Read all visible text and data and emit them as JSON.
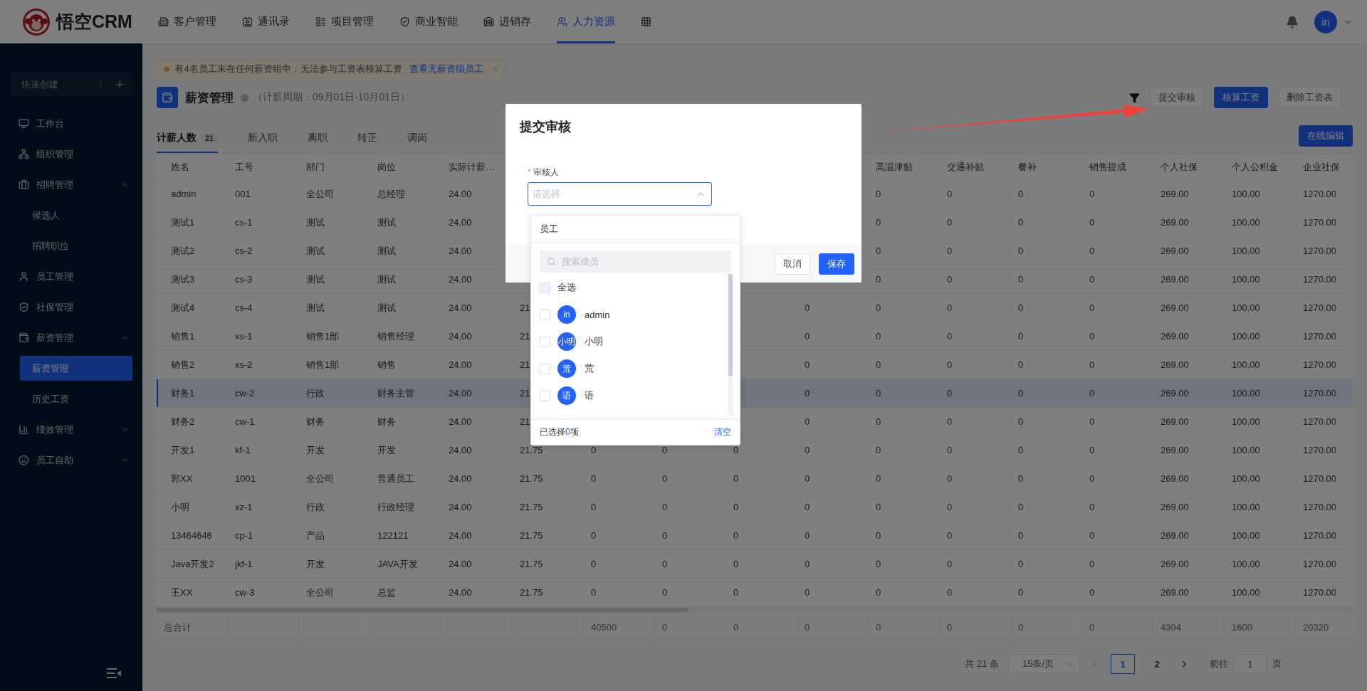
{
  "header": {
    "logo_text": "悟空CRM",
    "avatar": "in",
    "nav": [
      {
        "label": "客户管理",
        "selected": false
      },
      {
        "label": "通讯录",
        "selected": false
      },
      {
        "label": "项目管理",
        "selected": false
      },
      {
        "label": "商业智能",
        "selected": false
      },
      {
        "label": "进销存",
        "selected": false
      },
      {
        "label": "人力资源",
        "selected": true
      }
    ]
  },
  "sidebar": {
    "quick_create": "快速创建",
    "items": [
      {
        "label": "工作台",
        "selected": false
      },
      {
        "label": "组织管理",
        "selected": false
      },
      {
        "label": "招聘管理",
        "selected": false,
        "expanded": true,
        "children": [
          {
            "label": "候选人",
            "selected": false
          },
          {
            "label": "招聘职位",
            "selected": false
          }
        ]
      },
      {
        "label": "员工管理",
        "selected": false
      },
      {
        "label": "社保管理",
        "selected": false
      },
      {
        "label": "薪资管理",
        "selected": false,
        "expanded": true,
        "children": [
          {
            "label": "薪资管理",
            "selected": true
          },
          {
            "label": "历史工资",
            "selected": false
          }
        ]
      },
      {
        "label": "绩效管理",
        "selected": false,
        "expanded": false
      },
      {
        "label": "员工自助",
        "selected": false,
        "expanded": false
      }
    ]
  },
  "notice": {
    "text": "有4名员工未在任何薪资组中，无法参与工资表核算工资",
    "link": "查看无薪资组员工"
  },
  "page": {
    "title": "薪资管理",
    "period": "（计薪周期：09月01日-10月01日）",
    "actions": [
      {
        "label": "提交审核",
        "kind": "default"
      },
      {
        "label": "核算工资",
        "kind": "primary"
      },
      {
        "label": "删除工资表",
        "kind": "default"
      }
    ]
  },
  "tabs": [
    {
      "label": "计薪人数",
      "count": "21",
      "selected": true
    },
    {
      "label": "新入职",
      "selected": false
    },
    {
      "label": "离职",
      "selected": false
    },
    {
      "label": "转正",
      "selected": false
    },
    {
      "label": "调岗",
      "selected": false
    }
  ],
  "online_edit": "在线编辑",
  "table": {
    "columns": [
      "姓名",
      "工号",
      "部门",
      "岗位",
      "实际计薪…",
      null,
      null,
      null,
      null,
      null,
      "高温津贴",
      "交通补贴",
      "餐补",
      "销售提成",
      "个人社保",
      "个人公积金",
      "企业社保"
    ],
    "rows": [
      {
        "selected": false,
        "cells": [
          "admin",
          "001",
          "全公司",
          "总经理",
          "24.00",
          null,
          null,
          null,
          null,
          null,
          "0",
          "0",
          "0",
          "0",
          "269.00",
          "100.00",
          "1270.00"
        ]
      },
      {
        "selected": false,
        "cells": [
          "测试1",
          "cs-1",
          "测试",
          "测试",
          "24.00",
          null,
          null,
          null,
          null,
          null,
          "0",
          "0",
          "0",
          "0",
          "269.00",
          "100.00",
          "1270.00"
        ]
      },
      {
        "selected": false,
        "cells": [
          "测试2",
          "cs-2",
          "测试",
          "测试",
          "24.00",
          null,
          null,
          null,
          null,
          null,
          "0",
          "0",
          "0",
          "0",
          "269.00",
          "100.00",
          "1270.00"
        ]
      },
      {
        "selected": false,
        "cells": [
          "测试3",
          "cs-3",
          "测试",
          "测试",
          "24.00",
          null,
          null,
          null,
          null,
          null,
          "0",
          "0",
          "0",
          "0",
          "269.00",
          "100.00",
          "1270.00"
        ]
      },
      {
        "selected": false,
        "cells": [
          "测试4",
          "cs-4",
          "测试",
          "测试",
          "24.00",
          "21",
          null,
          null,
          null,
          "0",
          "0",
          "0",
          "0",
          "0",
          "269.00",
          "100.00",
          "1270.00"
        ]
      },
      {
        "selected": false,
        "cells": [
          "销售1",
          "xs-1",
          "销售1部",
          "销售经理",
          "24.00",
          "21",
          null,
          null,
          null,
          "0",
          "0",
          "0",
          "0",
          "0",
          "269.00",
          "100.00",
          "1270.00"
        ]
      },
      {
        "selected": false,
        "cells": [
          "销售2",
          "xs-2",
          "销售1部",
          "销售",
          "24.00",
          "21",
          null,
          null,
          null,
          "0",
          "0",
          "0",
          "0",
          "0",
          "269.00",
          "100.00",
          "1270.00"
        ]
      },
      {
        "selected": true,
        "cells": [
          "财务1",
          "cw-2",
          "行政",
          "财务主管",
          "24.00",
          "21",
          null,
          null,
          null,
          "0",
          "0",
          "0",
          "0",
          "0",
          "269.00",
          "100.00",
          "1270.00"
        ]
      },
      {
        "selected": false,
        "cells": [
          "财务2",
          "cw-1",
          "财务",
          "财务",
          "24.00",
          "21",
          null,
          null,
          null,
          "0",
          "0",
          "0",
          "0",
          "0",
          "269.00",
          "100.00",
          "1270.00"
        ]
      },
      {
        "selected": false,
        "cells": [
          "开发1",
          "kf-1",
          "开发",
          "开发",
          "24.00",
          "21.75",
          "0",
          "0",
          "0",
          "0",
          "0",
          "0",
          "0",
          "0",
          "269.00",
          "100.00",
          "1270.00"
        ]
      },
      {
        "selected": false,
        "cells": [
          "郭XX",
          "1001",
          "全公司",
          "普通员工",
          "24.00",
          "21.75",
          "0",
          "0",
          "0",
          "0",
          "0",
          "0",
          "0",
          "0",
          "269.00",
          "100.00",
          "1270.00"
        ]
      },
      {
        "selected": false,
        "cells": [
          "小明",
          "xz-1",
          "行政",
          "行政经理",
          "24.00",
          "21.75",
          "0",
          "0",
          "0",
          "0",
          "0",
          "0",
          "0",
          "0",
          "269.00",
          "100.00",
          "1270.00"
        ]
      },
      {
        "selected": false,
        "cells": [
          "13464646",
          "cp-1",
          "产品",
          "122121",
          "24.00",
          "21.75",
          "0",
          "0",
          "0",
          "0",
          "0",
          "0",
          "0",
          "0",
          "269.00",
          "100.00",
          "1270.00"
        ]
      },
      {
        "selected": false,
        "cells": [
          "Java开发2",
          "jkf-1",
          "开发",
          "JAVA开发",
          "24.00",
          "21.75",
          "0",
          "0",
          "0",
          "0",
          "0",
          "0",
          "0",
          "0",
          "269.00",
          "100.00",
          "1270.00"
        ]
      },
      {
        "selected": false,
        "cells": [
          "王XX",
          "cw-3",
          "全公司",
          "总监",
          "24.00",
          "21.75",
          "0",
          "0",
          "0",
          "0",
          "0",
          "0",
          "0",
          "0",
          "269.00",
          "100.00",
          "1270.00"
        ]
      }
    ],
    "total": {
      "label": "总合计",
      "values": [
        "40500",
        "0",
        "0",
        "0",
        "0",
        "0",
        "0",
        "0",
        "4304",
        "1600",
        "20320"
      ]
    }
  },
  "pagination": {
    "total": "共 21 条",
    "page_size": "15条/页",
    "prev_disabled": true,
    "next_disabled": false,
    "pages": [
      {
        "label": "1",
        "selected": true
      },
      {
        "label": "2",
        "selected": false
      }
    ],
    "goto_label": "前往",
    "goto_value": "1",
    "goto_suffix": "页"
  },
  "modal": {
    "title": "提交审核",
    "required_mark": "*",
    "field_label": "审核人",
    "placeholder": "请选择",
    "buttons": [
      {
        "label": "取消",
        "kind": "default"
      },
      {
        "label": "保存",
        "kind": "primary"
      }
    ]
  },
  "picker": {
    "tab": "员工",
    "search_placeholder": "搜索成员",
    "select_all": {
      "label": "全选",
      "checked": false
    },
    "members": [
      {
        "avatar": "in",
        "name": "admin",
        "checked": false
      },
      {
        "avatar": "小明",
        "name": "小明",
        "checked": false
      },
      {
        "avatar": "荒",
        "name": "荒",
        "checked": false
      },
      {
        "avatar": "语",
        "name": "语",
        "checked": false
      }
    ],
    "selected_prefix": "已选择",
    "selected_count": "0",
    "selected_suffix": "项",
    "clear": "清空"
  }
}
